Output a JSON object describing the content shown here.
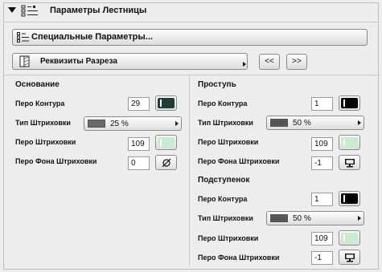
{
  "header": {
    "title": "Параметры Лестницы"
  },
  "special_button": {
    "label": "Специальные Параметры..."
  },
  "section_button": {
    "label": "Реквизиты Разреза"
  },
  "nav": {
    "prev": "<<",
    "next": ">>"
  },
  "base": {
    "title": "Основание",
    "rows": [
      {
        "label": "Перо Контура",
        "value": "29",
        "swatch": "#1f3e37"
      },
      {
        "label": "Тип Штриховки",
        "value": "25 %"
      },
      {
        "label": "Перо Штриховки",
        "value": "109",
        "swatch": "#c9ecd0"
      },
      {
        "label": "Перо Фона Штриховки",
        "value": "0",
        "icon": "null-pen-icon"
      }
    ]
  },
  "tread": {
    "title": "Проступь",
    "rows": [
      {
        "label": "Перо Контура",
        "value": "1",
        "swatch": "#000000"
      },
      {
        "label": "Тип Штриховки",
        "value": "50 %"
      },
      {
        "label": "Перо Штриховки",
        "value": "109",
        "swatch": "#c9ecd0"
      },
      {
        "label": "Перо Фона Штриховки",
        "value": "-1",
        "icon": "monitor-icon"
      }
    ]
  },
  "riser": {
    "title": "Подступенок",
    "rows": [
      {
        "label": "Перо Контура",
        "value": "1",
        "swatch": "#000000"
      },
      {
        "label": "Тип Штриховки",
        "value": "50 %"
      },
      {
        "label": "Перо Штриховки",
        "value": "109",
        "swatch": "#c9ecd0"
      },
      {
        "label": "Перо Фона Штриховки",
        "value": "-1",
        "icon": "monitor-icon"
      }
    ]
  }
}
